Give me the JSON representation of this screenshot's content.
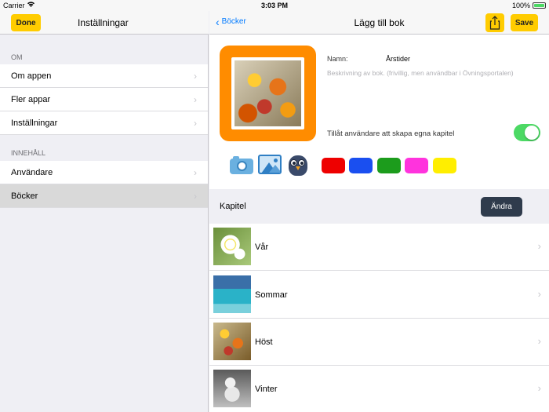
{
  "status_bar": {
    "carrier": "Carrier",
    "wifi_icon": "wifi-icon",
    "time": "3:03 PM",
    "battery": "100%"
  },
  "master": {
    "done_label": "Done",
    "title": "Inställningar",
    "sections": [
      {
        "header": "OM",
        "items": [
          "Om appen",
          "Fler appar",
          "Inställningar"
        ]
      },
      {
        "header": "INNEHÅLL",
        "items": [
          "Användare",
          "Böcker"
        ]
      }
    ],
    "selected_item": "Böcker"
  },
  "detail": {
    "back_label": "Böcker",
    "title": "Lägg till bok",
    "share_icon": "share-icon",
    "save_label": "Save",
    "name_label": "Namn:",
    "name_value": "Årstider",
    "description_placeholder": "Beskrivning av bok. (frivillig, men användbar i Övningsportalen)",
    "toggle_label": "Tillåt användare att skapa egna kapitel",
    "toggle_on": true,
    "tools": [
      "camera-icon",
      "image-icon",
      "owl-icon"
    ],
    "colors": [
      "#ee0000",
      "#1a4ff0",
      "#1c9c1c",
      "#ff33dd",
      "#ffee00"
    ],
    "accent_orange": "#ff8c00",
    "accent_yellow": "#ffcc00"
  },
  "chapters": {
    "header": "Kapitel",
    "edit_label": "Ändra",
    "items": [
      {
        "label": "Vår"
      },
      {
        "label": "Sommar"
      },
      {
        "label": "Höst"
      },
      {
        "label": "Vinter"
      }
    ]
  }
}
